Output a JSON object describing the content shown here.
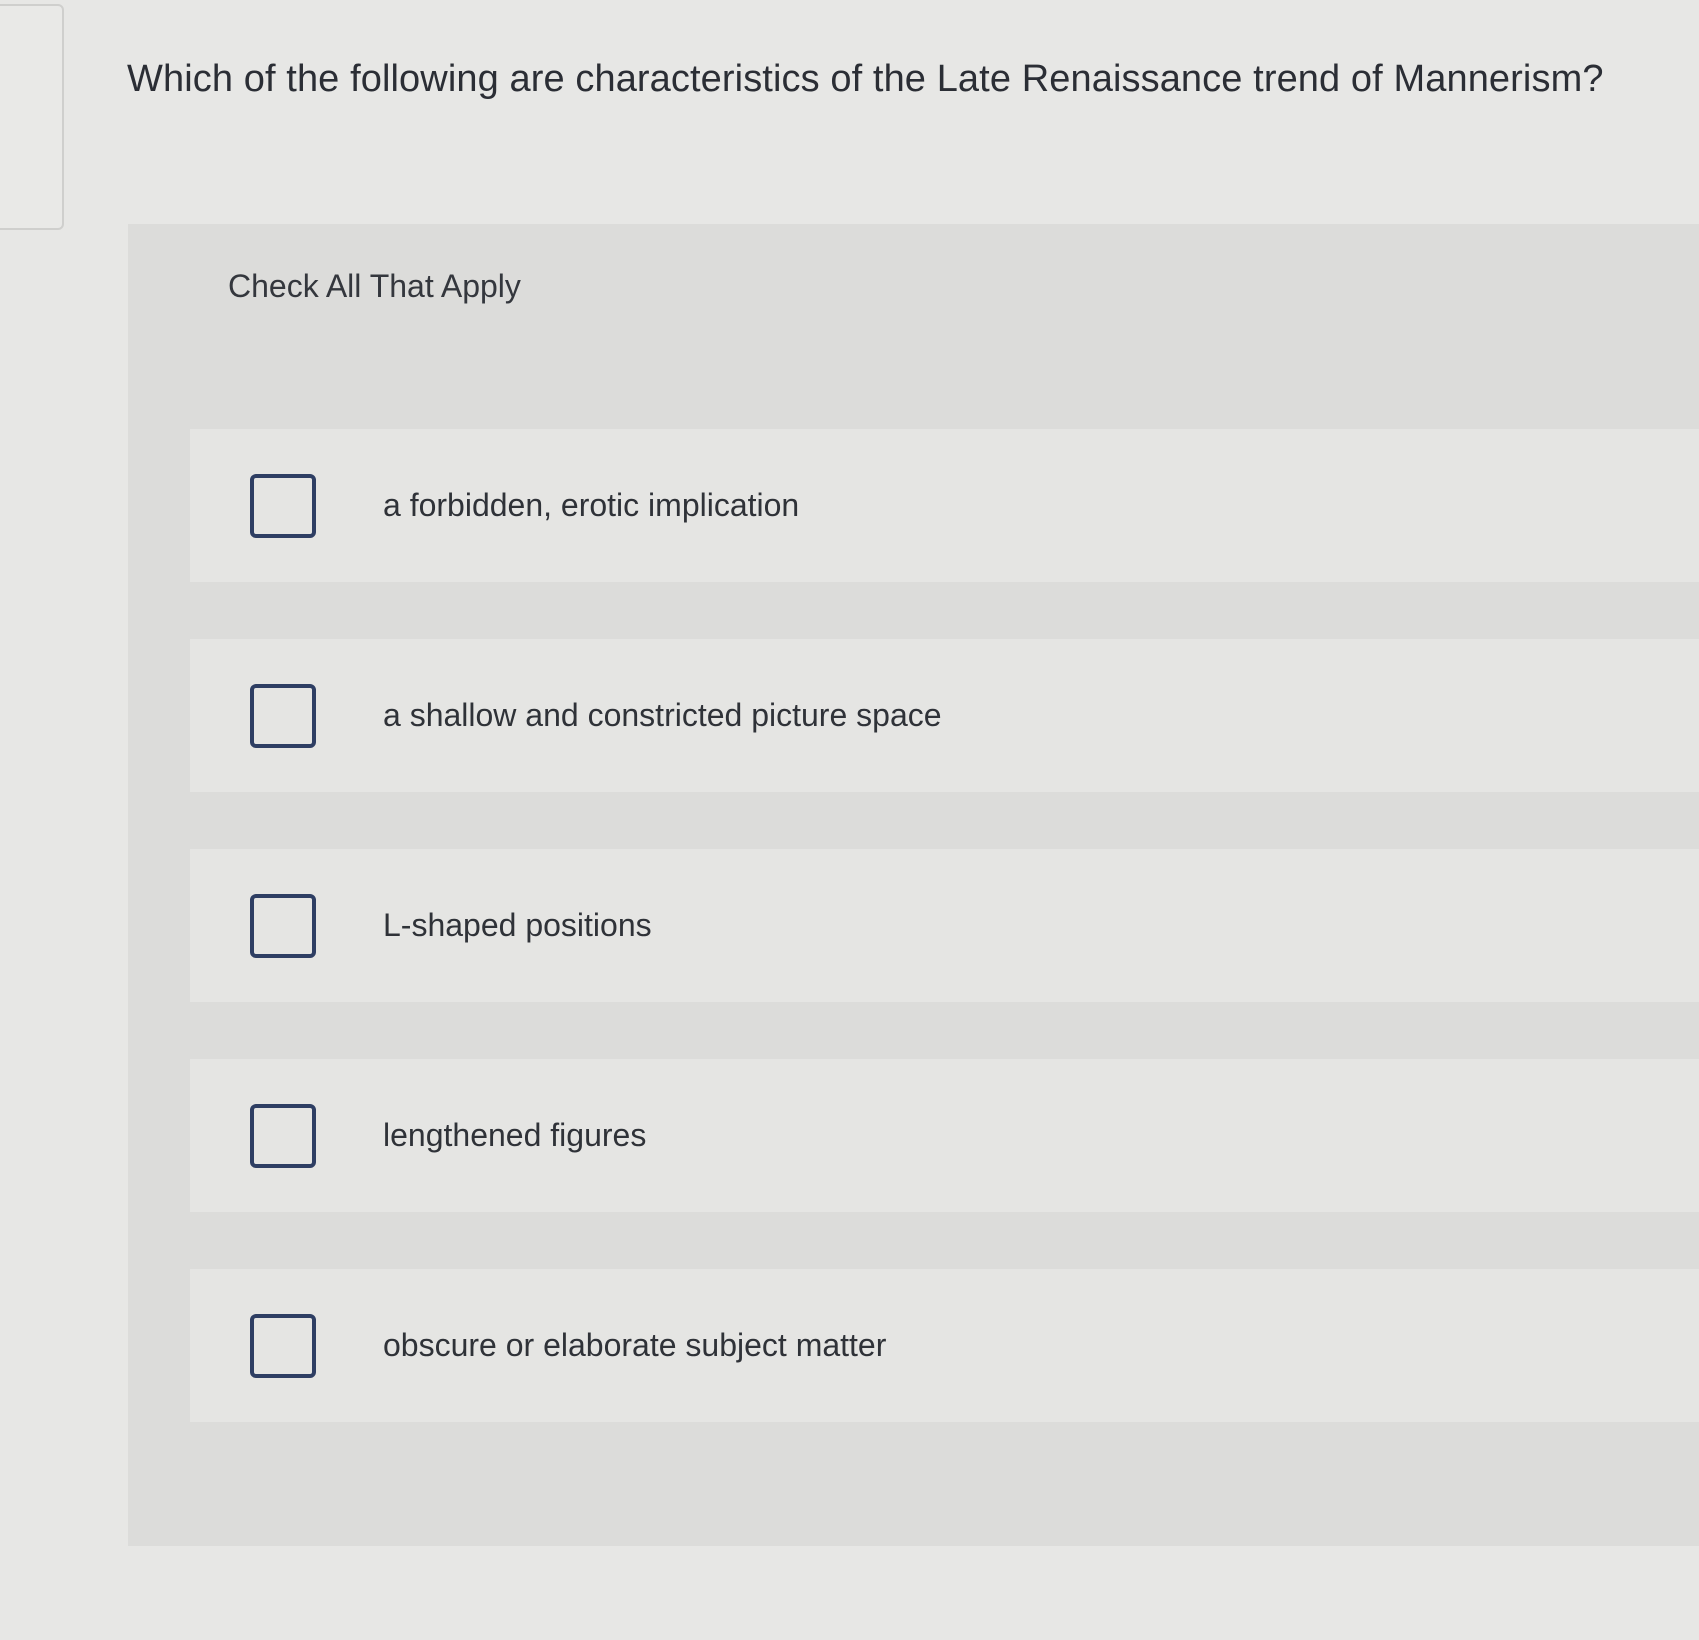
{
  "question": {
    "text": "Which of the following are characteristics of the Late Renaissance trend of Mannerism?"
  },
  "instruction": "Check All That Apply",
  "options": [
    {
      "label": "a forbidden, erotic implication",
      "checked": false
    },
    {
      "label": "a shallow and constricted picture space",
      "checked": false
    },
    {
      "label": "L-shaped positions",
      "checked": false
    },
    {
      "label": "lengthened figures",
      "checked": false
    },
    {
      "label": "obscure or elaborate subject matter",
      "checked": false
    }
  ],
  "colors": {
    "checkbox_border": "#2e3e63",
    "panel_background": "#dcdcda",
    "page_background": "#e7e7e5"
  }
}
